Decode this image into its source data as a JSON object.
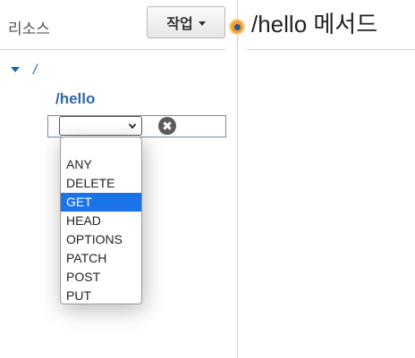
{
  "sidebar": {
    "title": "리소스",
    "actions_label": "작업",
    "root_path": "/",
    "resource": "/hello",
    "method_select": {
      "selected_value": "",
      "options": [
        "ANY",
        "DELETE",
        "GET",
        "HEAD",
        "OPTIONS",
        "PATCH",
        "POST",
        "PUT"
      ],
      "highlighted": "GET"
    },
    "cancel_glyph": "✖"
  },
  "main": {
    "title": "/hello 메서드"
  },
  "colors": {
    "link_blue": "#2c68a8",
    "highlight": "#1a73e8",
    "status_orange": "#f3a024"
  }
}
